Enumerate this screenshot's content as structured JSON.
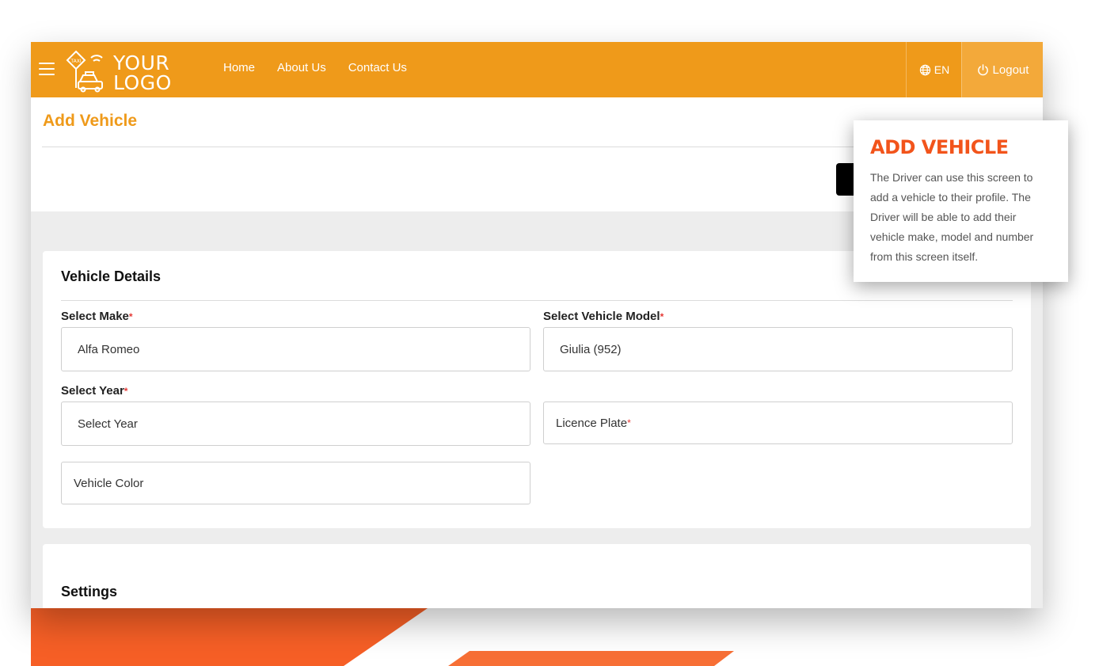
{
  "brand": {
    "logo_line1": "YOUR",
    "logo_line2": "LOGO",
    "accent": "#ef9a1a",
    "tooltip_accent": "#f2541b"
  },
  "nav": {
    "items": [
      "Home",
      "About Us",
      "Contact Us"
    ]
  },
  "header": {
    "language": "EN",
    "logout_label": "Logout"
  },
  "page": {
    "title": "Add Vehicle"
  },
  "vehicle_details": {
    "title": "Vehicle Details",
    "make_label": "Select Make",
    "make_value": "Alfa Romeo",
    "model_label": "Select Vehicle Model",
    "model_value": "Giulia (952)",
    "year_label": "Select Year",
    "year_value": "Select Year",
    "plate_placeholder": "Licence Plate",
    "color_placeholder": "Vehicle Color",
    "required_mark": "*"
  },
  "settings": {
    "title": "Settings"
  },
  "tooltip": {
    "title": "ADD VEHICLE",
    "body": "The Driver can use this screen to add a vehicle to their profile. The Driver will be able to add their vehicle make, model and number from this screen itself."
  }
}
